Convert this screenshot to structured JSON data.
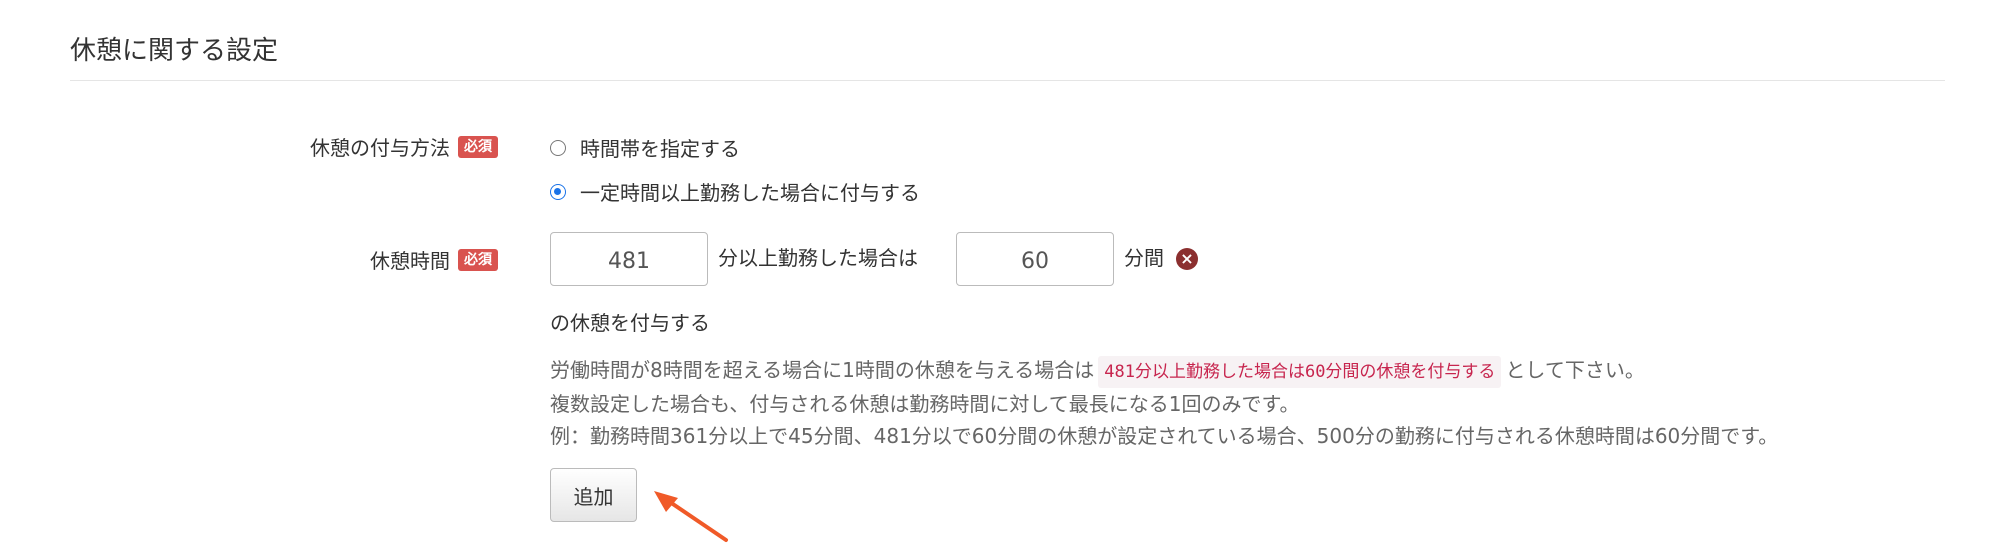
{
  "section": {
    "title": "休憩に関する設定"
  },
  "method": {
    "label": "休憩の付与方法",
    "required_badge": "必須",
    "options": [
      {
        "label": "時間帯を指定する",
        "checked": false
      },
      {
        "label": "一定時間以上勤務した場合に付与する",
        "checked": true
      }
    ]
  },
  "break_time": {
    "label": "休憩時間",
    "required_badge": "必須",
    "work_minutes": "481",
    "text_after_work": "分以上勤務した場合は",
    "break_minutes": "60",
    "text_after_break": "分間",
    "text_tail": "の休憩を付与する",
    "remove_icon": "times-circle-icon"
  },
  "help": {
    "line1_prefix": "労働時間が8時間を超える場合に1時間の休憩を与える場合は",
    "line1_code": "481分以上勤務した場合は60分間の休憩を付与する",
    "line1_suffix": "として下さい。",
    "line2": "複数設定した場合も、付与される休憩は勤務時間に対して最長になる1回のみです。",
    "line3": "例：勤務時間361分以上で45分間、481分以で60分間の休憩が設定されている場合、500分の勤務に付与される休憩時間は60分間です。"
  },
  "add_button": {
    "label": "追加"
  },
  "colors": {
    "badge": "#d9534f",
    "radio_checked": "#1a73e8",
    "annotation_arrow": "#f05a28",
    "code_text": "#c7254e"
  }
}
